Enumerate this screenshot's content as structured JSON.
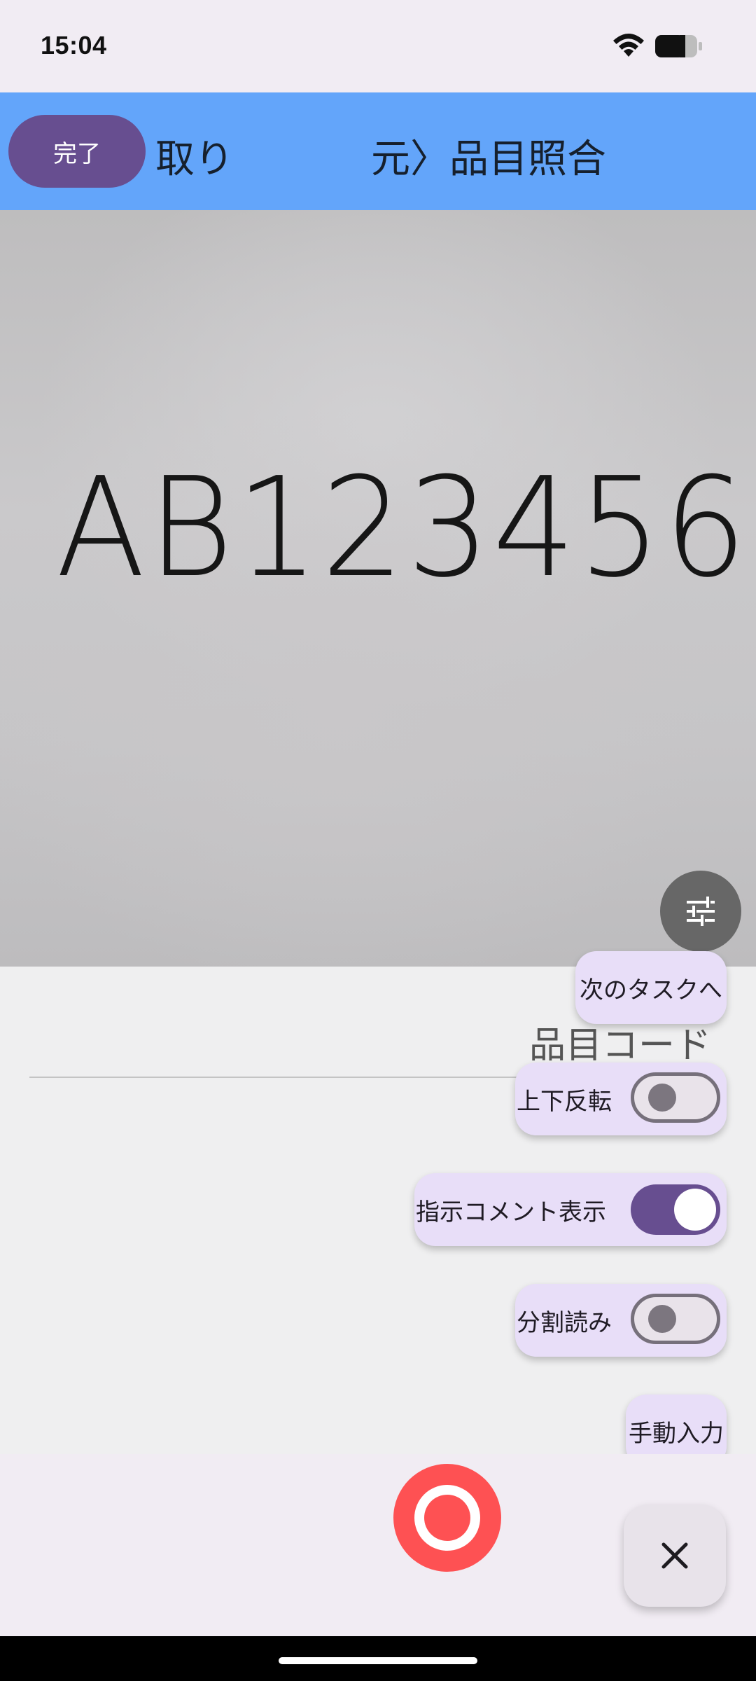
{
  "status_bar": {
    "time": "15:04",
    "icons": [
      "wifi-icon",
      "battery-icon"
    ]
  },
  "header": {
    "done_label": "完了",
    "title_left": "取り",
    "title_center": "元〉品目照合"
  },
  "camera": {
    "recognized_text": "AB123456",
    "settings_icon": "sliders-icon"
  },
  "field": {
    "label": "品目コード",
    "value": ""
  },
  "menu": {
    "next_task_label": "次のタスクへ",
    "flip_label": "上下反転",
    "flip_on": false,
    "comment_label": "指示コメント表示",
    "comment_on": true,
    "split_label": "分割読み",
    "split_on": false,
    "manual_label": "手動入力"
  },
  "bottom": {
    "shutter_icon": "shutter-icon",
    "close_icon": "close-icon"
  },
  "colors": {
    "header_bg": "#63a5fa",
    "accent": "#674e90",
    "pill_bg": "#e8def8",
    "shutter": "#fe5153"
  }
}
